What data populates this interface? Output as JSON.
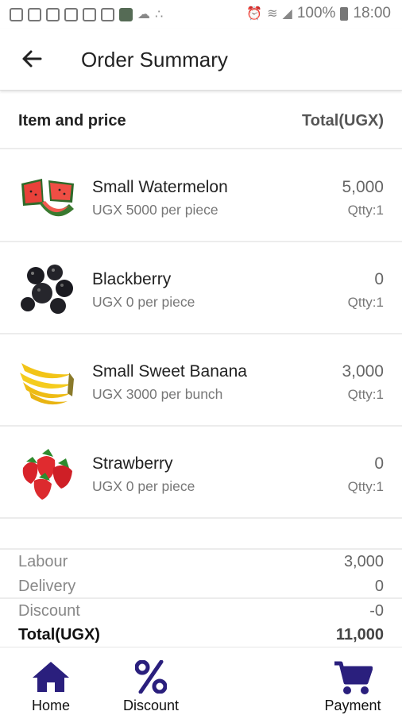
{
  "status_bar": {
    "battery": "100%",
    "time": "18:00"
  },
  "appbar": {
    "title": "Order Summary"
  },
  "header": {
    "left": "Item and price",
    "right": "Total(UGX)"
  },
  "items": [
    {
      "name": "Small Watermelon",
      "price": "UGX 5000 per piece",
      "total": "5,000",
      "qty": "Qtty:1",
      "image": "watermelon"
    },
    {
      "name": "Blackberry",
      "price": "UGX 0 per piece",
      "total": "0",
      "qty": "Qtty:1",
      "image": "blackberry"
    },
    {
      "name": "Small Sweet Banana",
      "price": "UGX 3000 per bunch",
      "total": "3,000",
      "qty": "Qtty:1",
      "image": "banana"
    },
    {
      "name": "Strawberry",
      "price": "UGX 0 per piece",
      "total": "0",
      "qty": "Qtty:1",
      "image": "strawberry"
    }
  ],
  "summary": {
    "labour_label": "Labour",
    "labour_value": "3,000",
    "delivery_label": "Delivery",
    "delivery_value": "0",
    "discount_label": "Discount",
    "discount_value": "-0",
    "total_label": "Total(UGX)",
    "total_value": "11,000"
  },
  "nav": {
    "home": "Home",
    "discount": "Discount",
    "payment": "Payment"
  },
  "colors": {
    "nav_icon": "#2a1f7d"
  }
}
